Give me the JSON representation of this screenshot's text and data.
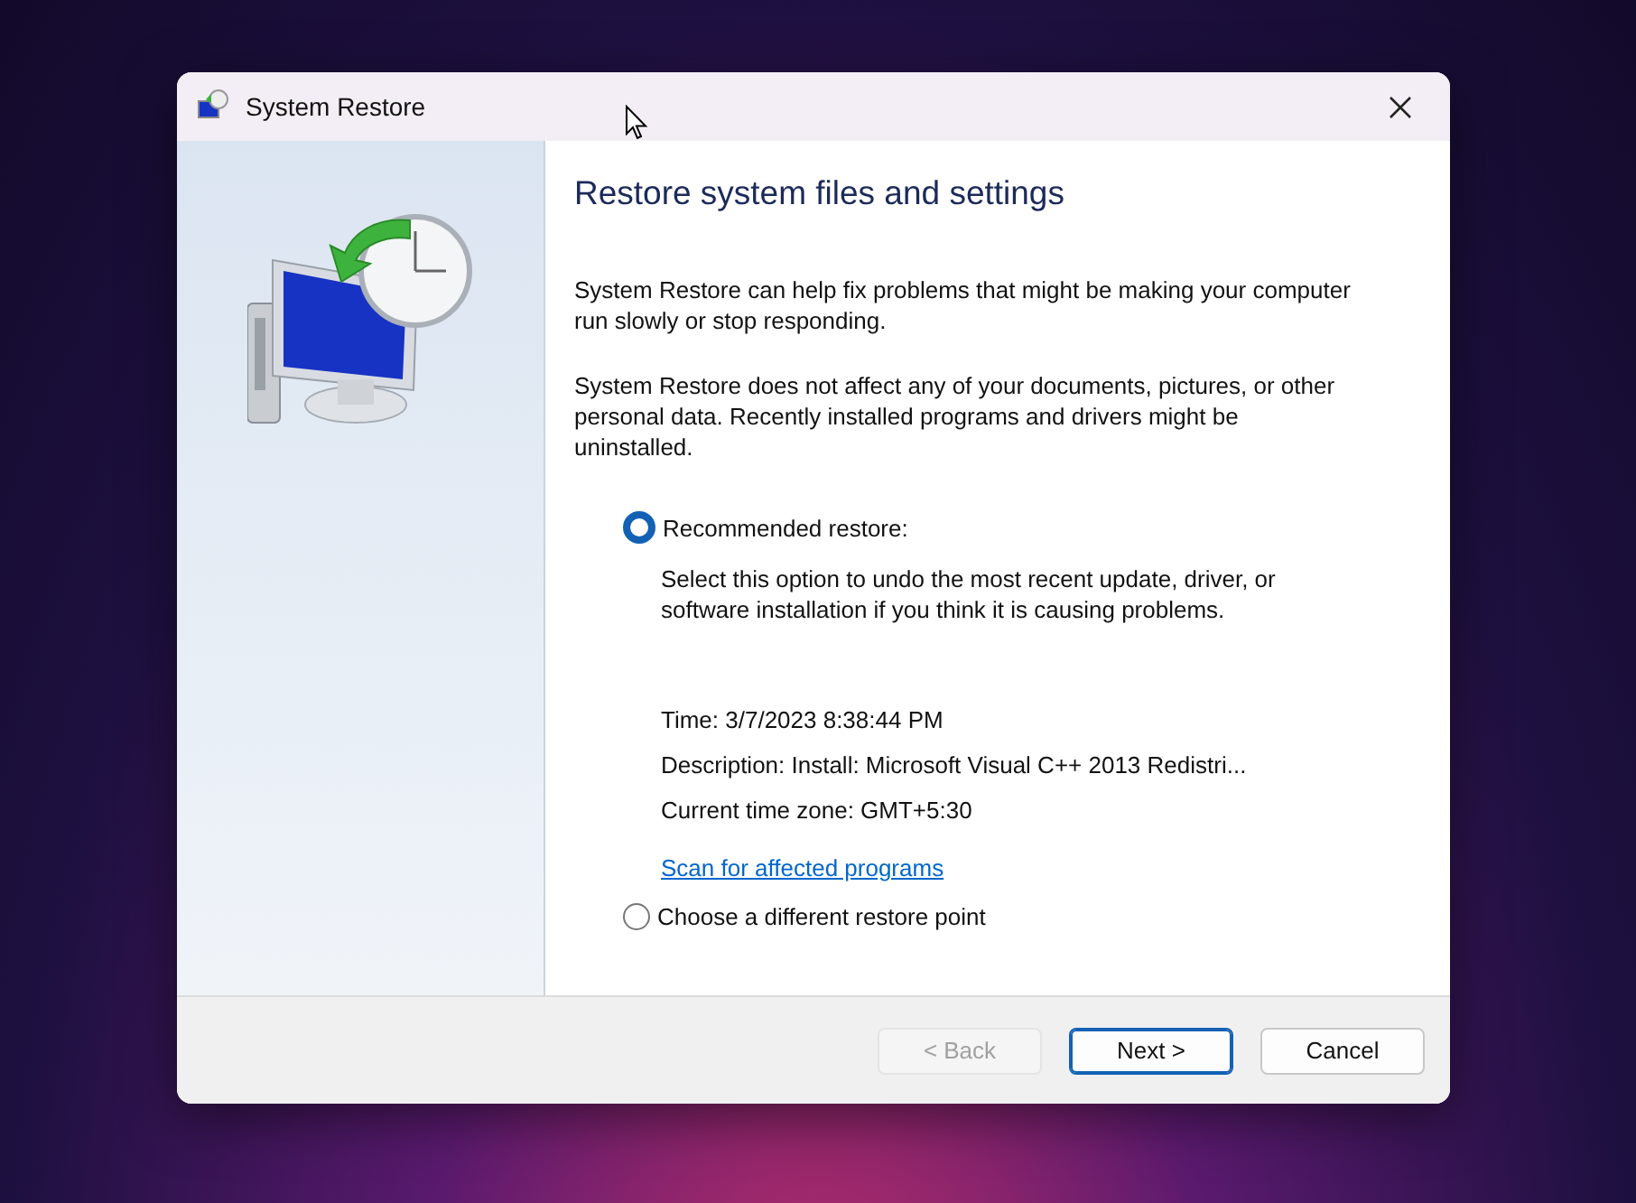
{
  "window": {
    "title": "System Restore"
  },
  "heading": "Restore system files and settings",
  "paragraphs": [
    "System Restore can help fix problems that might be making your computer run slowly or stop responding.",
    "System Restore does not affect any of your documents, pictures, or other personal data. Recently installed programs and drivers might be uninstalled."
  ],
  "options": [
    {
      "label": "Recommended restore:",
      "selected": true,
      "description": "Select this option to undo the most recent update, driver, or software installation if you think it is causing problems.",
      "details": [
        "Time: 3/7/2023 8:38:44 PM",
        "Description: Install: Microsoft Visual C++ 2013 Redistri...",
        "Current time zone: GMT+5:30"
      ],
      "link": "Scan for affected programs"
    },
    {
      "label": "Choose a different restore point",
      "selected": false
    }
  ],
  "buttons": [
    {
      "label": "< Back",
      "disabled": true,
      "default": false
    },
    {
      "label": "Next >",
      "disabled": false,
      "default": true
    },
    {
      "label": "Cancel",
      "disabled": false,
      "default": false
    }
  ]
}
